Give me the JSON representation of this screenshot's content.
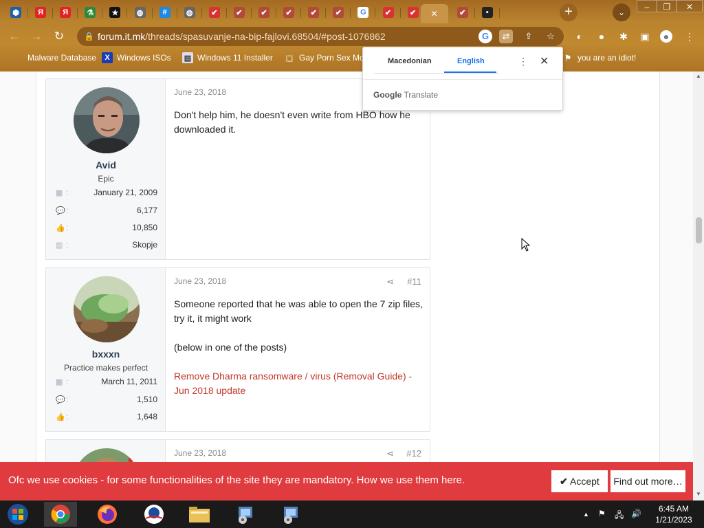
{
  "browser": {
    "tabs": [
      {
        "icon": "cube-icon",
        "color": "#1e5fa8",
        "glyph": "⬢"
      },
      {
        "icon": "yandex-icon",
        "color": "#e02424",
        "glyph": "Я"
      },
      {
        "icon": "yandex-icon",
        "color": "#e02424",
        "glyph": "Я"
      },
      {
        "icon": "flask-icon",
        "color": "#2a8a3a",
        "glyph": "⚗"
      },
      {
        "icon": "star-logo-icon",
        "color": "#111111",
        "glyph": "★"
      },
      {
        "icon": "globe-icon",
        "color": "#666666",
        "glyph": "◍"
      },
      {
        "icon": "hash-icon",
        "color": "#1e88e5",
        "glyph": "#"
      },
      {
        "icon": "globe-icon",
        "color": "#666666",
        "glyph": "◍"
      },
      {
        "icon": "forum-icon",
        "color": "#d83232",
        "glyph": "✔"
      },
      {
        "icon": "forum-icon",
        "color": "#b24a3a",
        "glyph": "✔"
      },
      {
        "icon": "forum-icon",
        "color": "#b24a3a",
        "glyph": "✔"
      },
      {
        "icon": "forum-icon",
        "color": "#b24a3a",
        "glyph": "✔"
      },
      {
        "icon": "forum-icon",
        "color": "#b24a3a",
        "glyph": "✔"
      },
      {
        "icon": "forum-icon",
        "color": "#b24a3a",
        "glyph": "✔"
      },
      {
        "icon": "google-icon",
        "color": "#ffffff",
        "glyph": "G"
      },
      {
        "icon": "forum-icon",
        "color": "#d83232",
        "glyph": "✔"
      },
      {
        "icon": "forum-icon",
        "color": "#d83232",
        "glyph": "✔"
      },
      {
        "icon": "forum-icon",
        "color": "#b24a3a",
        "glyph": "✔"
      },
      {
        "icon": "terminal-icon",
        "color": "#222222",
        "glyph": "▪"
      }
    ],
    "active_tab_close": "✕",
    "new_tab": "+",
    "url_domain": "forum.it.mk",
    "url_path": "/threads/spasuvanje-na-bip-fajlovi.68504/#post-1076862",
    "bookmarks": [
      {
        "label": "Malware Database",
        "icon": "malware-db-icon"
      },
      {
        "label": "Windows ISOs",
        "icon": "x-logo-icon"
      },
      {
        "label": "Windows 11 Installer",
        "icon": "installer-icon"
      },
      {
        "label": "Gay Porn Sex Mo",
        "icon": "box-icon"
      },
      {
        "label": "you are an idiot!",
        "icon": "flag-icon"
      }
    ]
  },
  "translate_popup": {
    "lang_source": "Macedonian",
    "lang_target": "English",
    "brand_google": "Google",
    "brand_translate": "Translate"
  },
  "posts": [
    {
      "username": "Avid",
      "title": "Epic",
      "stats": [
        {
          "icon": "calendar-icon",
          "value": "January 21, 2009"
        },
        {
          "icon": "messages-icon",
          "value": "6,177"
        },
        {
          "icon": "thumbs-up-icon",
          "value": "10,850"
        },
        {
          "icon": "map-icon",
          "value": "Skopje"
        }
      ],
      "date": "June 23, 2018",
      "number": "",
      "text": "Don't help him, he doesn't even write from HBO how he downloaded it."
    },
    {
      "username": "bxxxn",
      "title": "Practice makes perfect",
      "stats": [
        {
          "icon": "calendar-icon",
          "value": "March 11, 2011"
        },
        {
          "icon": "messages-icon",
          "value": "1,510"
        },
        {
          "icon": "thumbs-up-icon",
          "value": "1,648"
        }
      ],
      "date": "June 23, 2018",
      "number": "#11",
      "text1": "Someone reported that he was able to open the 7 zip files, try it, it might work",
      "text2": "(below in one of the posts)",
      "link": "Remove Dharma ransomware / virus (Removal Guide) - Jun 2018 update"
    },
    {
      "date": "June 23, 2018",
      "number": "#12"
    }
  ],
  "cookie_banner": {
    "text": "Ofc we use cookies - for some functionalities of the site they are mandatory. How we use them here.",
    "accept": "Accept",
    "more": "Find out more…"
  },
  "taskbar": {
    "time": "6:45 AM",
    "date": "1/21/2023"
  },
  "colors": {
    "accent_red": "#e03b3f",
    "link_red": "#c0392b",
    "google_blue": "#1a73e8"
  }
}
